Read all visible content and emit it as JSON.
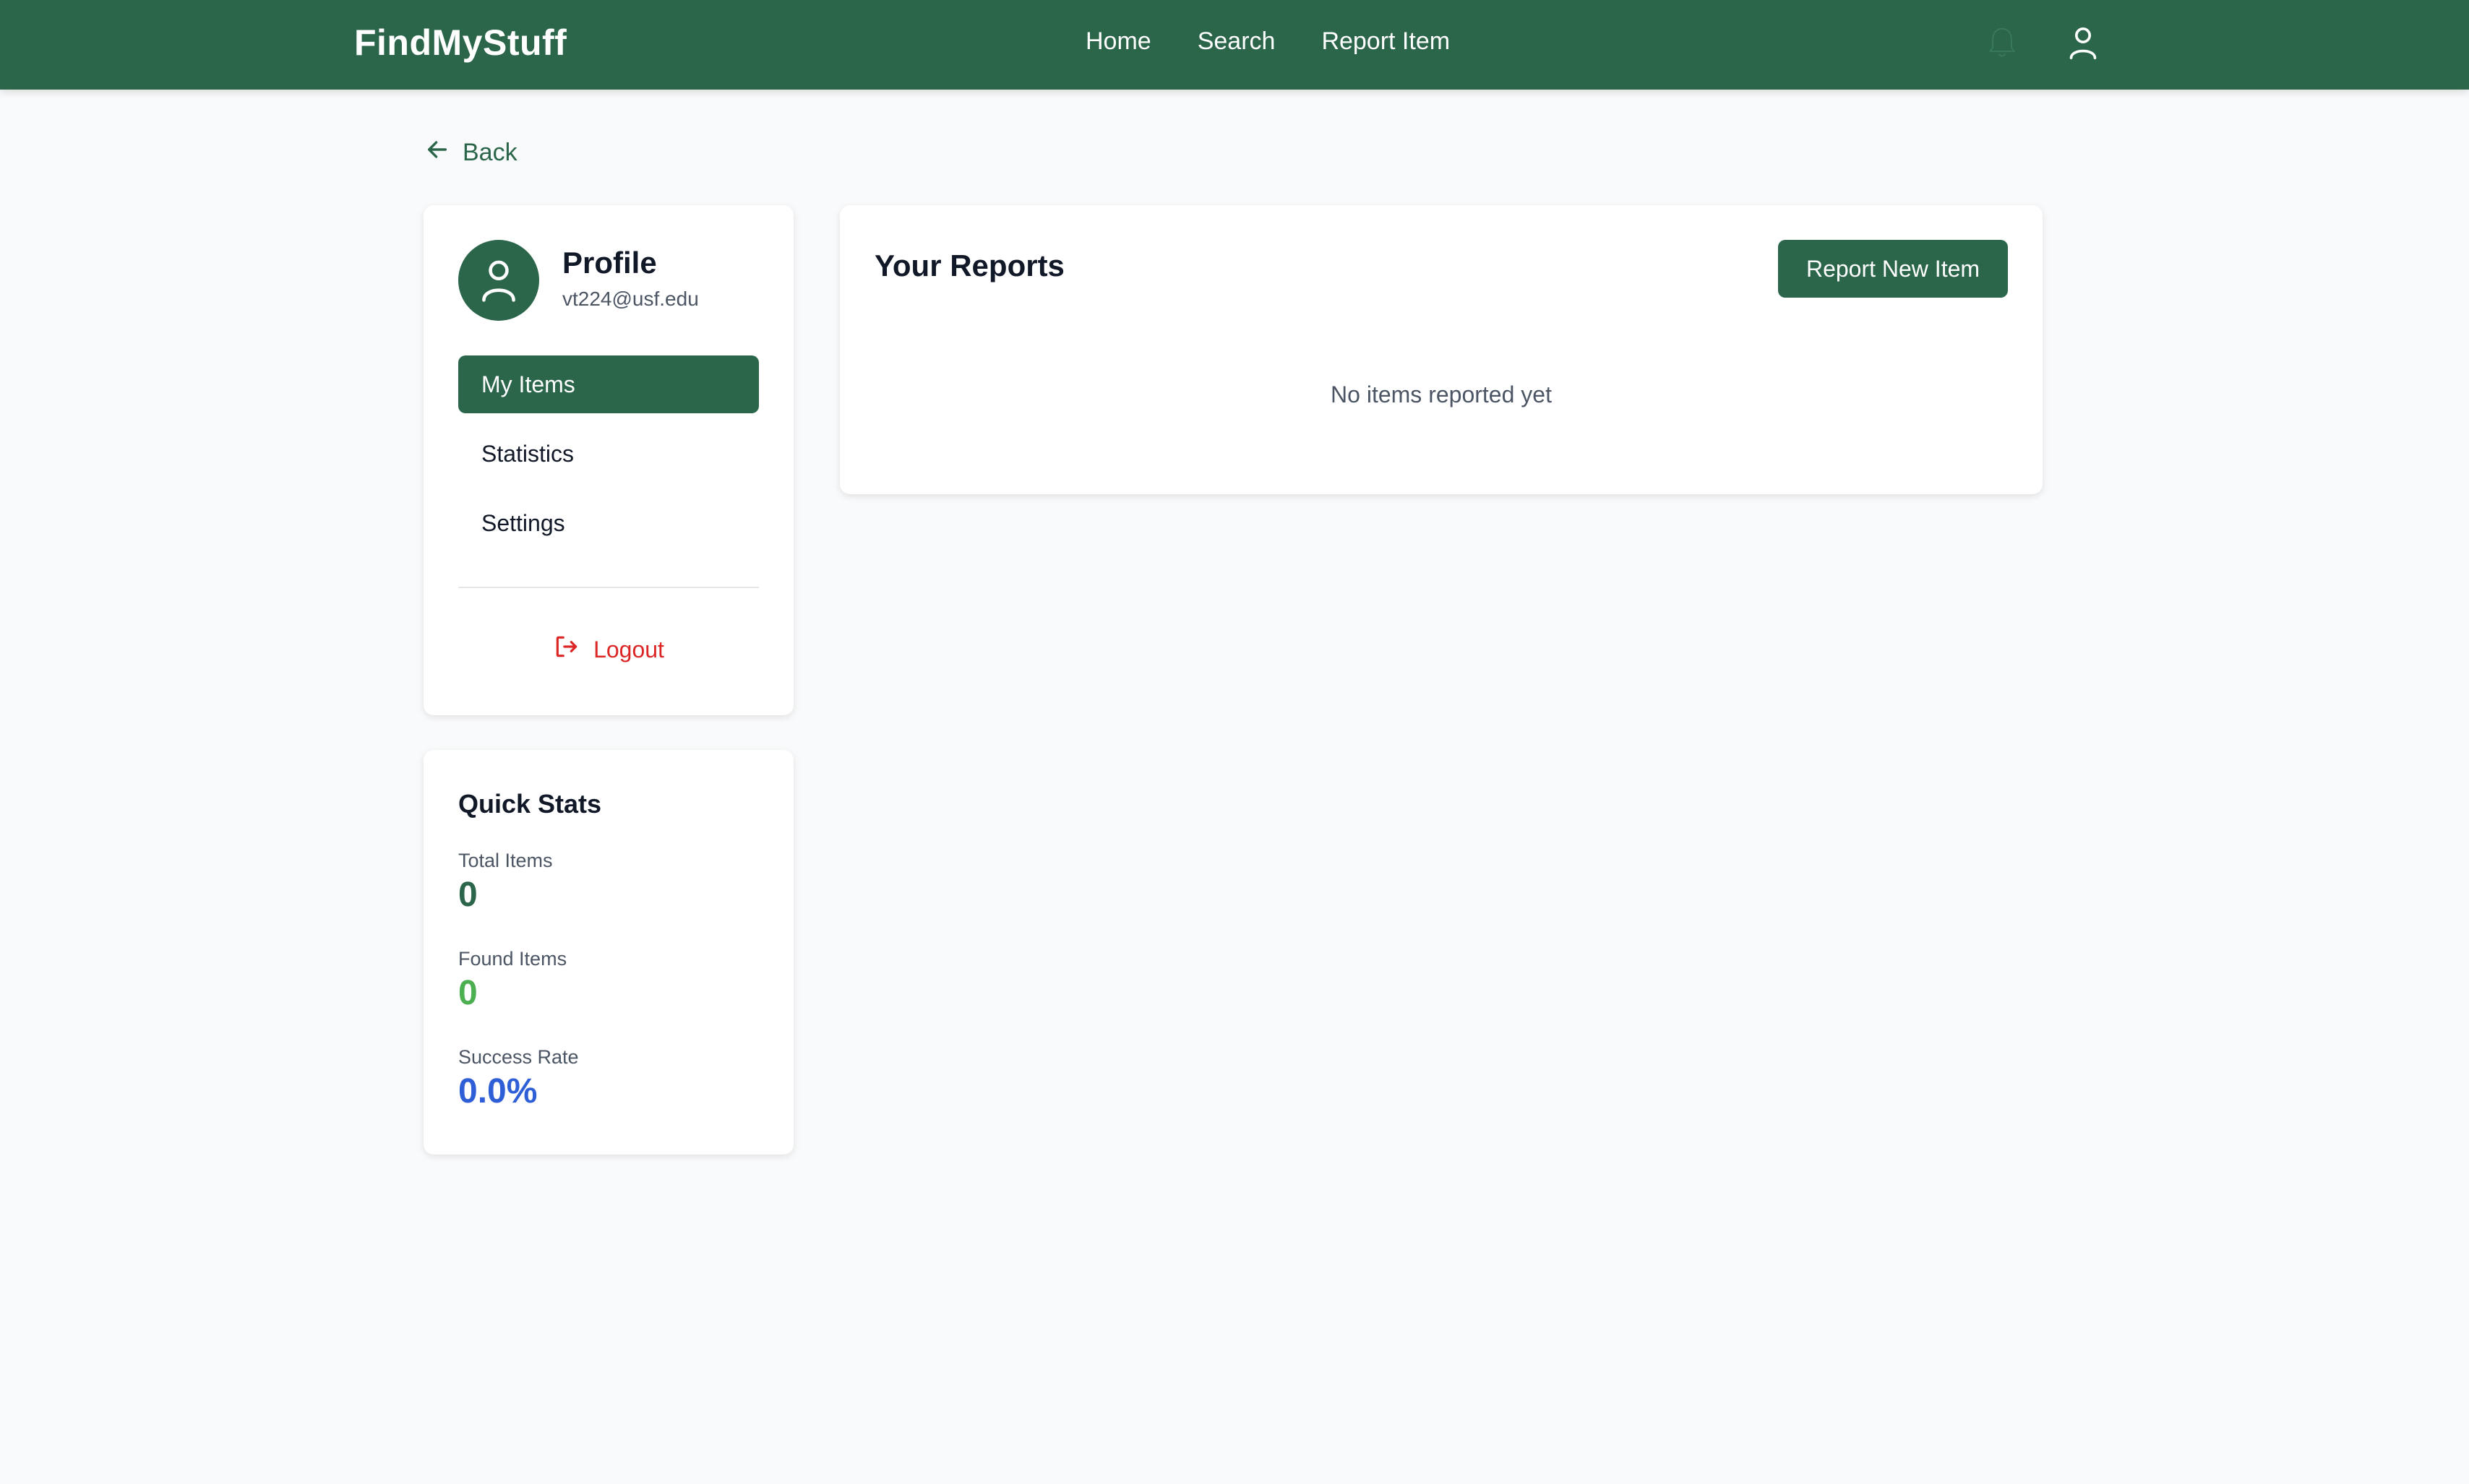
{
  "navbar": {
    "brand": "FindMyStuff",
    "links": [
      "Home",
      "Search",
      "Report Item"
    ],
    "icons": [
      "bell-icon",
      "user-icon"
    ]
  },
  "back": {
    "label": "Back",
    "icon": "arrow-left-icon"
  },
  "profile": {
    "title": "Profile",
    "email": "vt224@usf.edu",
    "menu": [
      "My Items",
      "Statistics",
      "Settings"
    ],
    "active_menu": "My Items",
    "logout_label": "Logout"
  },
  "quick_stats": {
    "title": "Quick Stats",
    "items": [
      {
        "label": "Total Items",
        "value": "0",
        "color": "#2b664b"
      },
      {
        "label": "Found Items",
        "value": "0",
        "color": "#4caf50"
      },
      {
        "label": "Success Rate",
        "value": "0.0%",
        "color": "#2f5fd6"
      }
    ]
  },
  "reports": {
    "title": "Your Reports",
    "button_label": "Report New Item",
    "empty_message": "No items reported yet"
  },
  "colors": {
    "primary": "#2b664b",
    "danger": "#dc2626",
    "background": "#f9fafb"
  }
}
